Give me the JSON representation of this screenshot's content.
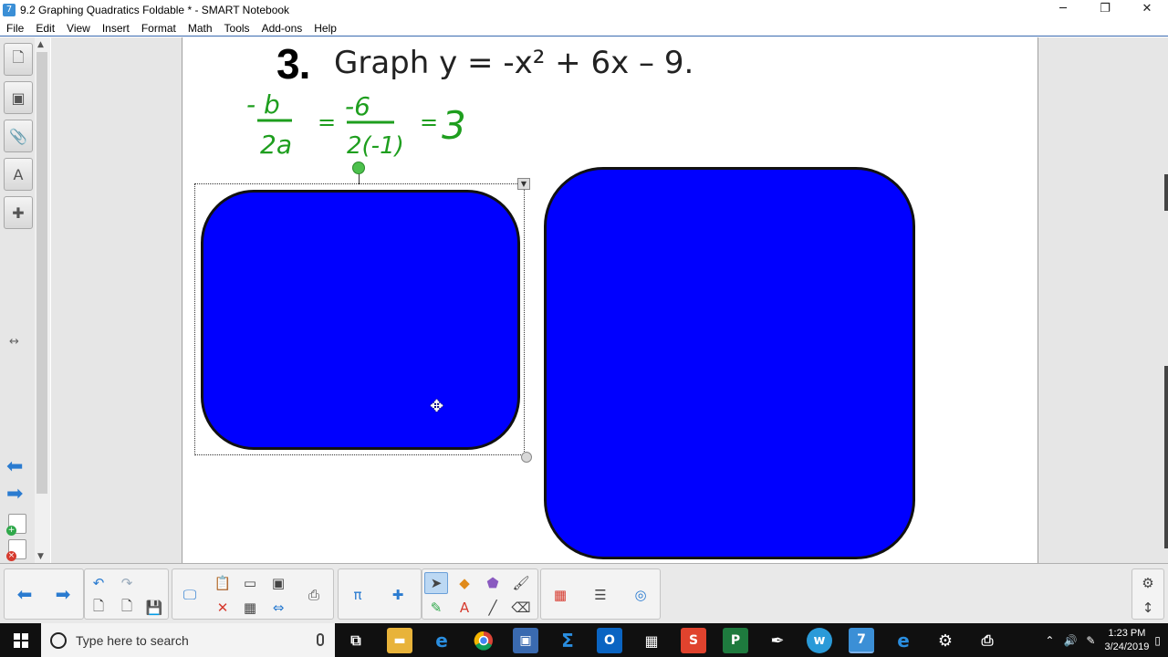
{
  "window": {
    "title": "9.2 Graphing Quadratics Foldable * - SMART Notebook",
    "minimize": "─",
    "restore": "❐",
    "close": "✕"
  },
  "menu": [
    "File",
    "Edit",
    "View",
    "Insert",
    "Format",
    "Math",
    "Tools",
    "Add-ons",
    "Help"
  ],
  "sidebar": {
    "tabs": [
      {
        "name": "page-sorter-icon",
        "glyph": "🗋"
      },
      {
        "name": "gallery-icon",
        "glyph": "▣"
      },
      {
        "name": "attachments-icon",
        "glyph": "📎"
      },
      {
        "name": "properties-icon",
        "glyph": "A"
      },
      {
        "name": "addons-icon",
        "glyph": "✚"
      }
    ],
    "resize_glyph": "↔",
    "back_glyph": "⬅",
    "forward_glyph": "➡"
  },
  "canvas": {
    "question_number": "3.",
    "question_text": "Graph y = -x² + 6x – 9.",
    "handwriting": {
      "numerator_1": "- b",
      "denominator_1": "2a",
      "equals_1": "=",
      "numerator_2": "-6",
      "denominator_2": "2(-1)",
      "equals_2": "=",
      "result": "3"
    },
    "shape_color": "#0000ff",
    "handwriting_color": "#1e9e1e"
  },
  "toolbar": {
    "groups": [
      {
        "name": "navigation",
        "buttons": [
          "prev-page",
          "next-page"
        ]
      },
      {
        "name": "edit",
        "buttons": [
          "undo",
          "redo",
          "add-page",
          "delete-page",
          "save"
        ]
      }
    ]
  },
  "taskbar": {
    "search_placeholder": "Type here to search",
    "clock_time": "1:23 PM",
    "clock_date": "3/24/2019"
  }
}
